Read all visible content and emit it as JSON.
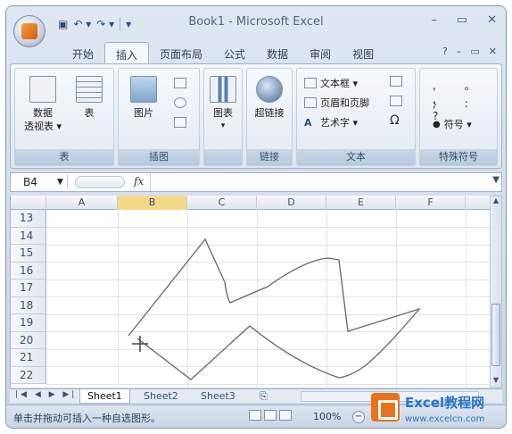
{
  "titlebar": {
    "title": "Book1 - Microsoft Excel",
    "minimize": "–",
    "restore": "▭",
    "close": "✕",
    "qat_save": "▣",
    "qat_undo": "↶ ▾",
    "qat_redo": "↷ ▾",
    "qat_more": "▾"
  },
  "tabs": [
    "开始",
    "插入",
    "页面布局",
    "公式",
    "数据",
    "审阅",
    "视图"
  ],
  "active_tab": "插入",
  "tab_right": {
    "help": "?",
    "min": "–",
    "restore": "▭",
    "close": "✕"
  },
  "ribbon": {
    "groups": [
      {
        "label": "表",
        "buttons": [
          "数据\n透视表 ▾",
          "表"
        ]
      },
      {
        "label": "插图",
        "buttons": [
          "图片"
        ]
      },
      {
        "label": "",
        "buttons": [
          "图表"
        ]
      },
      {
        "label": "链接",
        "buttons": [
          "超链接"
        ]
      },
      {
        "label": "文本",
        "buttons": [
          "文本框 ▾",
          "页眉和页脚",
          "艺术字 ▾",
          "Ω"
        ]
      },
      {
        "label": "特殊符号",
        "buttons": [
          "符号 ▾"
        ]
      }
    ]
  },
  "formula_bar": {
    "name_box": "B4",
    "fx": "fx"
  },
  "grid": {
    "columns": [
      "A",
      "B",
      "C",
      "D",
      "E",
      "F"
    ],
    "rows": [
      "13",
      "14",
      "15",
      "16",
      "17",
      "18",
      "19",
      "20",
      "21",
      "22"
    ]
  },
  "sheets": [
    "Sheet1",
    "Sheet2",
    "Sheet3"
  ],
  "active_sheet": "Sheet1",
  "status": {
    "text": "单击并拖动可插入一种自选图形。",
    "zoom": "100%"
  },
  "watermark": {
    "brand": "Excel教程网",
    "url": "www.excelcn.com"
  }
}
